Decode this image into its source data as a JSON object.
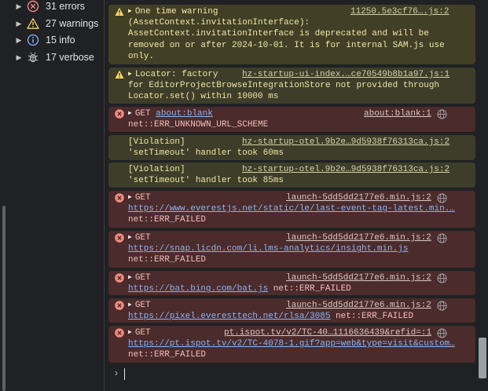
{
  "sidebar": {
    "items": [
      {
        "label": "31 errors",
        "icon": "error-icon",
        "color": "#f28b82"
      },
      {
        "label": "27 warnings",
        "icon": "warning-icon",
        "color": "#fdd663"
      },
      {
        "label": "15 info",
        "icon": "info-icon",
        "color": "#8ab4f8"
      },
      {
        "label": "17 verbose",
        "icon": "bug-icon",
        "color": "#c4c4c4"
      }
    ]
  },
  "console": {
    "messages": [
      {
        "level": "warning",
        "lines": [
          "One time warning",
          "(AssetContext.invitationInterface):",
          "AssetContext.invitationInterface is deprecated and will be",
          "removed on or after 2024-10-01. It is for internal SAM.js use",
          "only."
        ],
        "source": "11250.5e3cf76….js:2"
      },
      {
        "level": "warning",
        "lines": [
          "Locator: factory",
          "for EditorProjectBrowseIntegrationStore not provided through",
          "Locator.set() within 10000 ms"
        ],
        "source": "hz-startup-ui-index.…ce70549b8b1a97.js:1"
      },
      {
        "level": "error",
        "lines": [
          "GET ",
          "net::ERR_UNKNOWN_URL_SCHEME"
        ],
        "url": "about:blank",
        "source": "about:blank:1"
      },
      {
        "level": "violation",
        "lines": [
          "[Violation]",
          "'setTimeout' handler took 60ms"
        ],
        "source": "hz-startup-otel.9b2e…9d5938f76313ca.js:2"
      },
      {
        "level": "violation",
        "lines": [
          "[Violation]",
          "'setTimeout' handler took 85ms"
        ],
        "source": "hz-startup-otel.9b2e…9d5938f76313ca.js:2"
      },
      {
        "level": "error",
        "lines": [
          "GET",
          "net::ERR_FAILED"
        ],
        "url": "https://www.everestjs.net/static/le/last-event-tag-latest.min.…",
        "source": "launch-5dd5dd2177e6.min.js:2"
      },
      {
        "level": "error",
        "lines": [
          "GET",
          "net::ERR_FAILED"
        ],
        "url": "https://snap.licdn.com/li.lms-analytics/insight.min.js",
        "source": "launch-5dd5dd2177e6.min.js:2"
      },
      {
        "level": "error",
        "lines": [
          "GET",
          " net::ERR_FAILED"
        ],
        "url": "https://bat.bing.com/bat.js",
        "source": "launch-5dd5dd2177e6.min.js:2"
      },
      {
        "level": "error",
        "lines": [
          "GET",
          " net::ERR_FAILED"
        ],
        "url": "https://pixel.everesttech.net/rlsa/3085",
        "source": "launch-5dd5dd2177e6.min.js:2"
      },
      {
        "level": "error",
        "lines": [
          "GET",
          "net::ERR_FAILED"
        ],
        "url": "https://pt.ispot.tv/v2/TC-4078-1.gif?app=web&type=visit&custom…",
        "source": "pt.ispot.tv/v2/TC-40…1116636439&refid=:1"
      }
    ],
    "prompt": "›"
  }
}
